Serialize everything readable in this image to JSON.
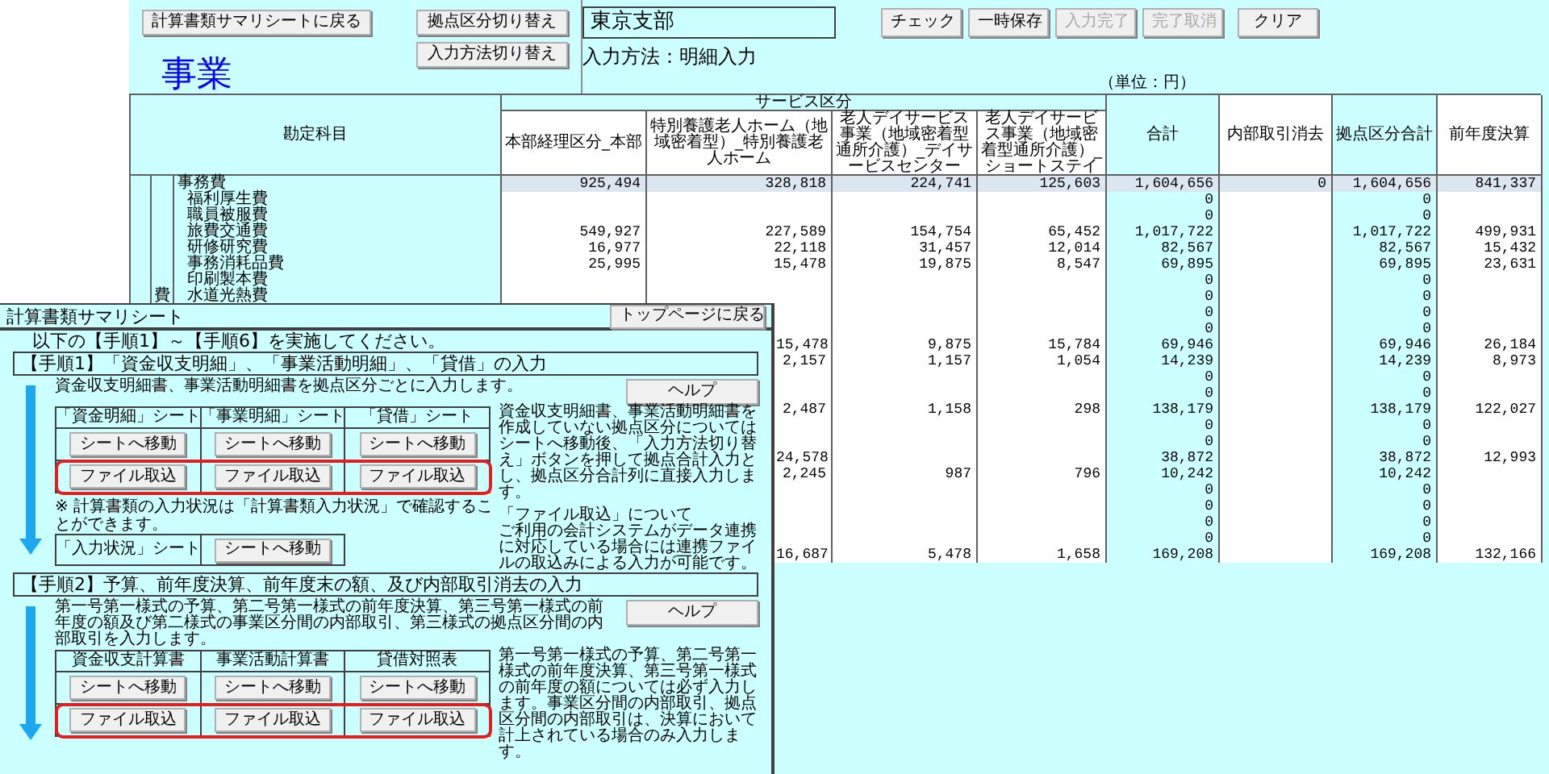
{
  "toolbar": {
    "back_button": "計算書類サマリシートに戻る",
    "title": "事業",
    "switch_buttons": [
      "拠点区分切り替え",
      "入力方法切り替え"
    ],
    "office_field": {
      "value": "東京支部"
    },
    "input_method": "入力方法：明細入力",
    "actions": [
      {
        "label": "チェック",
        "disabled": false
      },
      {
        "label": "一時保存",
        "disabled": false
      },
      {
        "label": "入力完了",
        "disabled": true
      },
      {
        "label": "完了取消",
        "disabled": true
      },
      {
        "label": "クリア",
        "disabled": false
      }
    ]
  },
  "sheet": {
    "unit": "（単位：円）",
    "account_header": "勘定科目",
    "group_header": "サービス区分",
    "columns": [
      {
        "label": "本部経理区分_本部",
        "shaded": false
      },
      {
        "label": "特別養護老人ホーム（地域密着型）_特別養護老人ホーム",
        "shaded": false
      },
      {
        "label": "老人デイサービス事業（地域密着型通所介護）_デイサービスセンター",
        "shaded": false
      },
      {
        "label": "老人デイサービス事業（地域密着型通所介護）_ショートステイ",
        "shaded": false
      },
      {
        "label": "合計",
        "shaded": true
      },
      {
        "label": "内部取引消去",
        "shaded": false
      },
      {
        "label": "拠点区分合計",
        "shaded": true
      },
      {
        "label": "前年度決算",
        "shaded": false
      }
    ],
    "rows": [
      {
        "label": "事務費",
        "kind": "subtotal",
        "highlighted": true,
        "cells": [
          "925,494",
          "328,818",
          "224,741",
          "125,603",
          "1,604,656",
          "0",
          "1,604,656",
          "841,337"
        ]
      },
      {
        "label": "福利厚生費",
        "kind": "item",
        "highlighted": false,
        "cells": [
          null,
          null,
          null,
          null,
          "0",
          null,
          "0",
          null
        ]
      },
      {
        "label": "職員被服費",
        "kind": "item",
        "highlighted": false,
        "cells": [
          null,
          null,
          null,
          null,
          "0",
          null,
          "0",
          null
        ]
      },
      {
        "label": "旅費交通費",
        "kind": "item",
        "highlighted": false,
        "cells": [
          "549,927",
          "227,589",
          "154,754",
          "65,452",
          "1,017,722",
          null,
          "1,017,722",
          "499,931"
        ]
      },
      {
        "label": "研修研究費",
        "kind": "item",
        "highlighted": false,
        "cells": [
          "16,977",
          "22,118",
          "31,457",
          "12,014",
          "82,567",
          null,
          "82,567",
          "15,432"
        ]
      },
      {
        "label": "事務消耗品費",
        "kind": "item",
        "highlighted": false,
        "cells": [
          "25,995",
          "15,478",
          "19,875",
          "8,547",
          "69,895",
          null,
          "69,895",
          "23,631"
        ]
      },
      {
        "label": "印刷製本費",
        "kind": "item",
        "highlighted": false,
        "cells": [
          null,
          null,
          null,
          null,
          "0",
          null,
          "0",
          null
        ]
      },
      {
        "label": "水道光熱費",
        "kind": "item",
        "category": "費",
        "highlighted": false,
        "cells": [
          null,
          null,
          null,
          null,
          "0",
          null,
          "0",
          null
        ]
      },
      {
        "highlighted": false,
        "cells": [
          null,
          null,
          null,
          null,
          "0",
          null,
          "0",
          null
        ]
      },
      {
        "highlighted": false,
        "cells": [
          null,
          null,
          null,
          null,
          "0",
          null,
          "0",
          null
        ]
      },
      {
        "highlighted": false,
        "cells": [
          null,
          "15,478",
          "9,875",
          "15,784",
          "69,946",
          null,
          "69,946",
          "26,184"
        ]
      },
      {
        "highlighted": false,
        "cells": [
          null,
          "2,157",
          "1,157",
          "1,054",
          "14,239",
          null,
          "14,239",
          "8,973"
        ]
      },
      {
        "highlighted": false,
        "cells": [
          null,
          null,
          null,
          null,
          "0",
          null,
          "0",
          null
        ]
      },
      {
        "highlighted": false,
        "cells": [
          null,
          null,
          null,
          null,
          "0",
          null,
          "0",
          null
        ]
      },
      {
        "highlighted": false,
        "cells": [
          null,
          "2,487",
          "1,158",
          "298",
          "138,179",
          null,
          "138,179",
          "122,027"
        ]
      },
      {
        "highlighted": false,
        "cells": [
          null,
          null,
          null,
          null,
          "0",
          null,
          "0",
          null
        ]
      },
      {
        "highlighted": false,
        "cells": [
          null,
          null,
          null,
          null,
          "0",
          null,
          "0",
          null
        ]
      },
      {
        "highlighted": false,
        "cells": [
          null,
          "24,578",
          null,
          null,
          "38,872",
          null,
          "38,872",
          "12,993"
        ]
      },
      {
        "highlighted": false,
        "cells": [
          null,
          "2,245",
          "987",
          "796",
          "10,242",
          null,
          "10,242",
          null
        ]
      },
      {
        "highlighted": false,
        "cells": [
          null,
          null,
          null,
          null,
          "0",
          null,
          "0",
          null
        ]
      },
      {
        "highlighted": false,
        "cells": [
          null,
          null,
          null,
          null,
          "0",
          null,
          "0",
          null
        ]
      },
      {
        "highlighted": false,
        "cells": [
          null,
          null,
          null,
          null,
          "0",
          null,
          "0",
          null
        ]
      },
      {
        "highlighted": false,
        "cells": [
          null,
          null,
          null,
          null,
          "0",
          null,
          "0",
          null
        ]
      },
      {
        "highlighted": false,
        "cells": [
          null,
          "16,687",
          "5,478",
          "1,658",
          "169,208",
          null,
          "169,208",
          "132,166"
        ]
      }
    ]
  },
  "summary": {
    "title": "計算書類サマリシート",
    "top_button": "トップページに戻る",
    "instruction": "以下の【手順1】～【手順6】を実施してください。",
    "steps": [
      {
        "heading": "【手順1】「資金収支明細」、「事業活動明細」、「貸借」の入力",
        "help": "ヘルプ",
        "intro": "資金収支明細書、事業活動明細書を拠点区分ごとに入力します。",
        "headers": [
          "「資金明細」シート",
          "「事業明細」シート",
          "「貸借」シート"
        ],
        "button_rows": [
          {
            "buttons": [
              "シートへ移動",
              "シートへ移動",
              "シートへ移動"
            ],
            "highlighted": false
          },
          {
            "buttons": [
              "ファイル取込",
              "ファイル取込",
              "ファイル取込"
            ],
            "highlighted": true
          }
        ],
        "footnote": "※ 計算書類の入力状況は「計算書類入力状況」で確認することができます。",
        "status_table": {
          "label": "「入力状況」シート",
          "button": "シートへ移動"
        },
        "notes": [
          "資金収支明細書、事業活動明細書を作成していない拠点区分についてはシートへ移動後、「入力方法切り替え」ボタンを押して拠点合計入力とし、拠点区分合計列に直接入力します。",
          "「ファイル取込」について",
          "ご利用の会計システムがデータ連携に対応している場合には連携ファイルの取込みによる入力が可能です。"
        ]
      },
      {
        "heading": "【手順2】予算、前年度決算、前年度末の額、及び内部取引消去の入力",
        "help": "ヘルプ",
        "intro": "第一号第一様式の予算、第二号第一様式の前年度決算、第三号第一様式の前年度の額及び第二様式の事業区分間の内部取引、第三様式の拠点区分間の内部取引を入力します。",
        "headers": [
          "資金収支計算書",
          "事業活動計算書",
          "貸借対照表"
        ],
        "button_rows": [
          {
            "buttons": [
              "シートへ移動",
              "シートへ移動",
              "シートへ移動"
            ],
            "highlighted": false
          },
          {
            "buttons": [
              "ファイル取込",
              "ファイル取込",
              "ファイル取込"
            ],
            "highlighted": true
          }
        ],
        "notes": [
          "第一号第一様式の予算、第二号第一様式の前年度決算、第三号第一様式の前年度の額については必ず入力します。事業区分間の内部取引、拠点区分間の内部取引は、決算において計上されている場合のみ入力します。"
        ]
      }
    ]
  }
}
